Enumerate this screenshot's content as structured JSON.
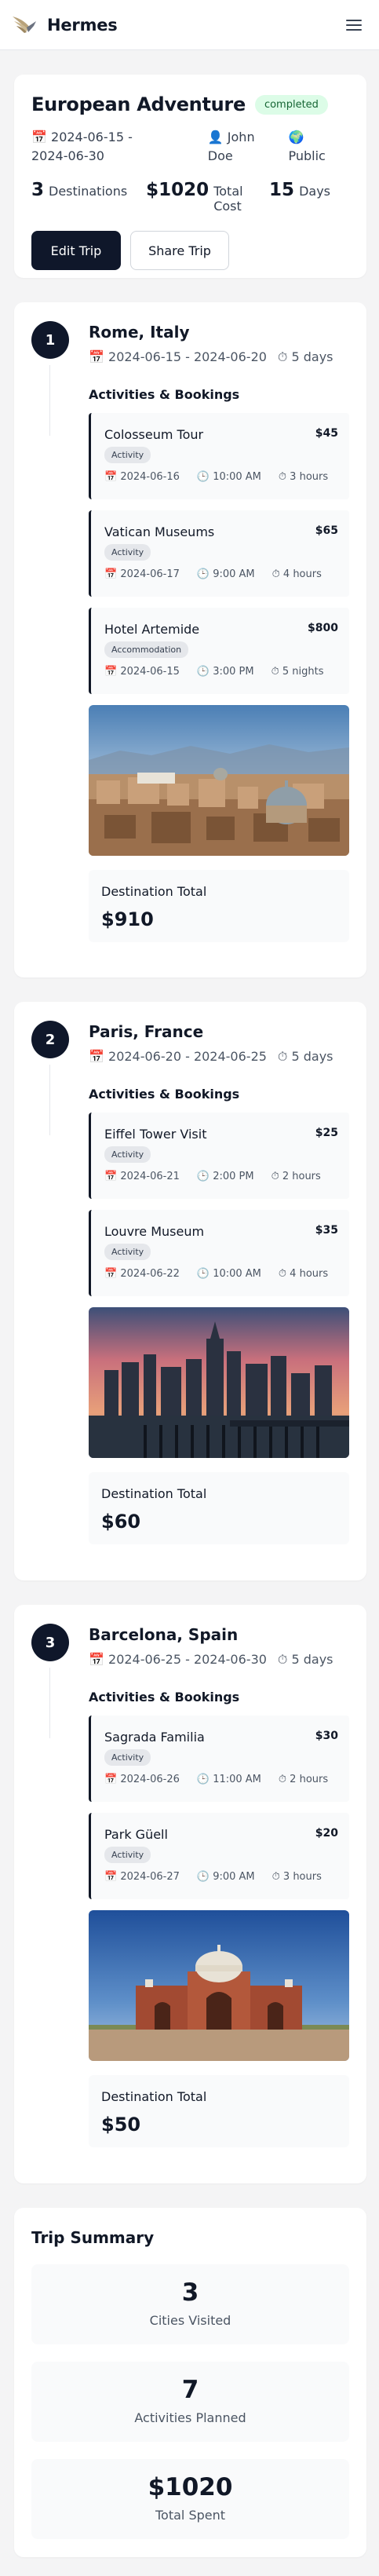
{
  "header": {
    "brand_name": "Hermes",
    "logo_icon": "winged-logo-icon",
    "menu_icon": "hamburger-menu-icon"
  },
  "trip": {
    "title": "European Adventure",
    "status": "completed",
    "dates_line1": "📅 2024-06-15 -",
    "dates_line2": "2024-06-30",
    "owner_line1": "👤 John",
    "owner_line2": "Doe",
    "visibility_line1": "🌍",
    "visibility_line2": "Public",
    "stats": {
      "destinations_value": "3",
      "destinations_label": "Destinations",
      "cost_value": "$1020",
      "cost_label": "Total Cost",
      "days_value": "15",
      "days_label": "Days"
    },
    "edit_button": "Edit Trip",
    "share_button": "Share Trip"
  },
  "destinations": [
    {
      "number": "1",
      "name": "Rome, Italy",
      "dates": "📅 2024-06-15 - 2024-06-20",
      "duration": "⏱ 5 days",
      "section_label": "Activities & Bookings",
      "bookings": [
        {
          "title": "Colosseum Tour",
          "price": "$45",
          "type": "Activity",
          "date": "📅 2024-06-16",
          "time": "🕒 10:00 AM",
          "duration": "⏱ 3 hours"
        },
        {
          "title": "Vatican Museums",
          "price": "$65",
          "type": "Activity",
          "date": "📅 2024-06-17",
          "time": "🕒 9:00 AM",
          "duration": "⏱ 4 hours"
        },
        {
          "title": "Hotel Artemide",
          "price": "$800",
          "type": "Accommodation",
          "date": "📅 2024-06-15",
          "time": "🕒 3:00 PM",
          "duration": "⏱ 5 nights"
        }
      ],
      "total_label": "Destination Total",
      "total_value": "$910"
    },
    {
      "number": "2",
      "name": "Paris, France",
      "dates": "📅 2024-06-20 - 2024-06-25",
      "duration": "⏱ 5 days",
      "section_label": "Activities & Bookings",
      "bookings": [
        {
          "title": "Eiffel Tower Visit",
          "price": "$25",
          "type": "Activity",
          "date": "📅 2024-06-21",
          "time": "🕒 2:00 PM",
          "duration": "⏱ 2 hours"
        },
        {
          "title": "Louvre Museum",
          "price": "$35",
          "type": "Activity",
          "date": "📅 2024-06-22",
          "time": "🕒 10:00 AM",
          "duration": "⏱ 4 hours"
        }
      ],
      "total_label": "Destination Total",
      "total_value": "$60"
    },
    {
      "number": "3",
      "name": "Barcelona, Spain",
      "dates": "📅 2024-06-25 - 2024-06-30",
      "duration": "⏱ 5 days",
      "section_label": "Activities & Bookings",
      "bookings": [
        {
          "title": "Sagrada Familia",
          "price": "$30",
          "type": "Activity",
          "date": "📅 2024-06-26",
          "time": "🕒 11:00 AM",
          "duration": "⏱ 2 hours"
        },
        {
          "title": "Park Güell",
          "price": "$20",
          "type": "Activity",
          "date": "📅 2024-06-27",
          "time": "🕒 9:00 AM",
          "duration": "⏱ 3 hours"
        }
      ],
      "total_label": "Destination Total",
      "total_value": "$50"
    }
  ],
  "summary": {
    "title": "Trip Summary",
    "items": [
      {
        "value": "3",
        "label": "Cities Visited"
      },
      {
        "value": "7",
        "label": "Activities Planned"
      },
      {
        "value": "$1020",
        "label": "Total Spent"
      }
    ]
  },
  "colors": {
    "primary": "#0f172a",
    "status_bg": "#dcfce7",
    "status_text": "#166534",
    "page_bg": "#f4f4f5"
  }
}
